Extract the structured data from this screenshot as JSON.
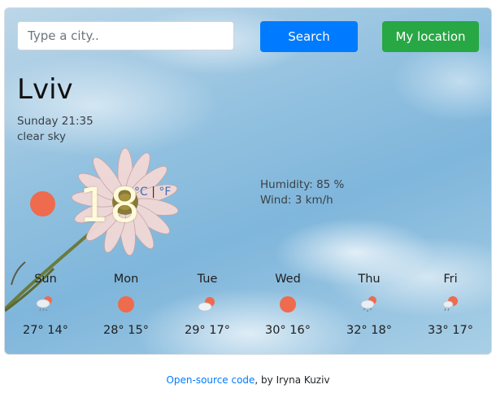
{
  "search": {
    "placeholder": "Type a city..",
    "value": "",
    "button_label": "Search"
  },
  "location_button_label": "My location",
  "city": "Lviv",
  "datetime": "Sunday 21:35",
  "description": "clear sky",
  "current": {
    "temperature": "18",
    "icon": "sun-icon",
    "unit_celsius": "°C",
    "unit_separator": "|",
    "unit_fahrenheit": "°F",
    "humidity_text": "Humidity: 85 %",
    "wind_text": "Wind: 3 km/h"
  },
  "forecast": [
    {
      "day": "Sun",
      "temps": "27° 14°",
      "icon": "rain-snow-icon"
    },
    {
      "day": "Mon",
      "temps": "28° 15°",
      "icon": "sun-icon"
    },
    {
      "day": "Tue",
      "temps": "29° 17°",
      "icon": "partly-cloudy-icon"
    },
    {
      "day": "Wed",
      "temps": "30° 16°",
      "icon": "sun-icon"
    },
    {
      "day": "Thu",
      "temps": "32° 18°",
      "icon": "cloud-snow-icon"
    },
    {
      "day": "Fri",
      "temps": "33° 17°",
      "icon": "rain-sun-icon"
    }
  ],
  "footer": {
    "link_text": "Open-source code",
    "suffix": ", by Iryna Kuziv"
  },
  "colors": {
    "search_button": "#007bff",
    "location_button": "#28a745",
    "sun": "#ee6b4d",
    "link": "#007bff"
  }
}
